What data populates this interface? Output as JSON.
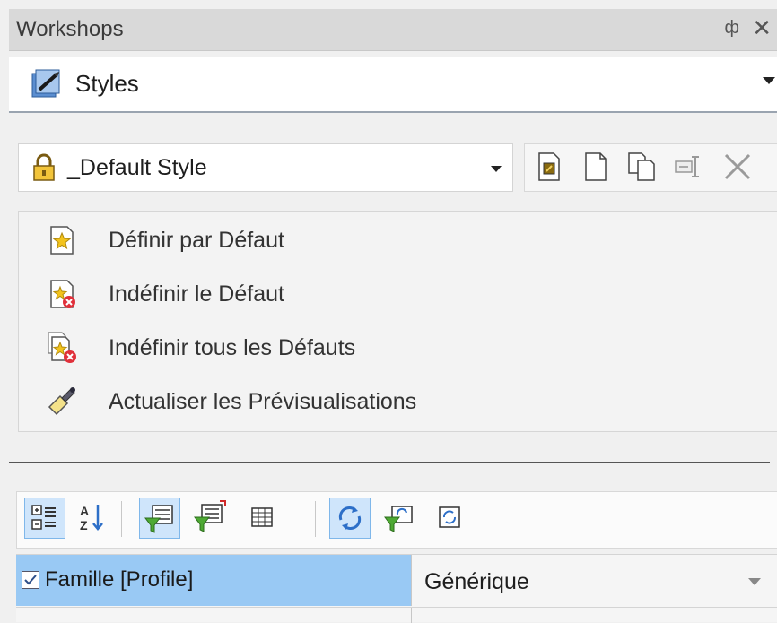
{
  "panel": {
    "title": "Workshops",
    "pin_glyph": "ф",
    "close_glyph": "✕"
  },
  "workshop_selector": {
    "value": "Styles",
    "icon": "styles-workshop-icon"
  },
  "style_selector": {
    "value": "_Default Style",
    "icon": "lock-icon"
  },
  "style_toolbar": {
    "buttons": [
      "edit-style-icon",
      "new-style-icon",
      "duplicate-style-icon",
      "rename-style-icon",
      "delete-style-icon"
    ]
  },
  "actions": [
    {
      "label": "Définir par Défaut",
      "icon": "set-default-icon"
    },
    {
      "label": "Indéfinir le Défaut",
      "icon": "unset-default-icon"
    },
    {
      "label": "Indéfinir tous les Défauts",
      "icon": "unset-all-defaults-icon"
    },
    {
      "label": "Actualiser les Prévisualisations",
      "icon": "refresh-previews-icon"
    }
  ],
  "property_toolbar": {
    "buttons": [
      "categorized-icon",
      "sort-az-icon",
      "filter-grid-icon",
      "filter-grid-red-icon",
      "grid-icon",
      "refresh-icon",
      "filter-refresh-icon",
      "refresh-box-icon"
    ],
    "active": [
      "categorized-icon",
      "filter-grid-icon",
      "refresh-icon"
    ]
  },
  "property_grid": {
    "rows": [
      {
        "name": "Famille [Profile]",
        "checked": true,
        "value": "Générique"
      }
    ]
  },
  "colors": {
    "selected_row": "#99c9f4",
    "active_button": "#cfe5fb",
    "titlebar": "#d9d9d9"
  }
}
